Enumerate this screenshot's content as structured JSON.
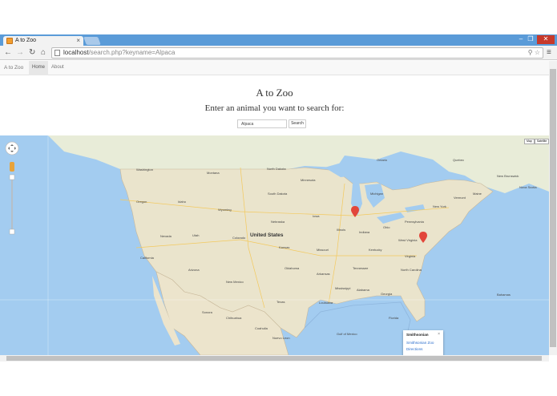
{
  "browser": {
    "tab_title": "A to Zoo",
    "tab_close": "×",
    "url_host": "localhost",
    "url_path": "/search.php?keyname=Alpaca",
    "win_min": "–",
    "win_max": "❐",
    "win_close": "✕"
  },
  "navbar": {
    "brand": "A to Zoo",
    "items": [
      "Home",
      "About"
    ]
  },
  "main": {
    "title": "A to Zoo",
    "subtitle": "Enter an animal you want to search for:",
    "search_value": "Alpaca",
    "search_button": "Search"
  },
  "map": {
    "country_label": "United States",
    "map_type_buttons": [
      "Map",
      "Satellite"
    ],
    "labels": [
      "Washington",
      "Montana",
      "North Dakota",
      "Minnesota",
      "Oregon",
      "Idaho",
      "Wyoming",
      "South Dakota",
      "Nebraska",
      "Iowa",
      "Illinois",
      "Indiana",
      "Ohio",
      "Pennsylvania",
      "New York",
      "Nevada",
      "Utah",
      "Colorado",
      "Kansas",
      "Missouri",
      "Kentucky",
      "West Virginia",
      "Virginia",
      "California",
      "Arizona",
      "New Mexico",
      "Oklahoma",
      "Arkansas",
      "Tennessee",
      "North Carolina",
      "Texas",
      "Louisiana",
      "Mississippi",
      "Alabama",
      "Georgia",
      "Florida",
      "Chihuahua",
      "Sonora",
      "Coahuila",
      "Nuevo Leon",
      "Ontario",
      "Quebec",
      "Maine",
      "New Brunswick",
      "Nova Scotia",
      "Gulf of Mexico",
      "Bahamas",
      "Vermont",
      "Michigan"
    ],
    "info_window": {
      "title": "Smithsonian",
      "link1": "Smithsonian Zoo",
      "link2": "Directions",
      "close": "×"
    },
    "colors": {
      "water": "#a3ccf0",
      "land": "#eae4cc",
      "canada": "#e8ecd8",
      "marker": "#e2463a"
    }
  }
}
